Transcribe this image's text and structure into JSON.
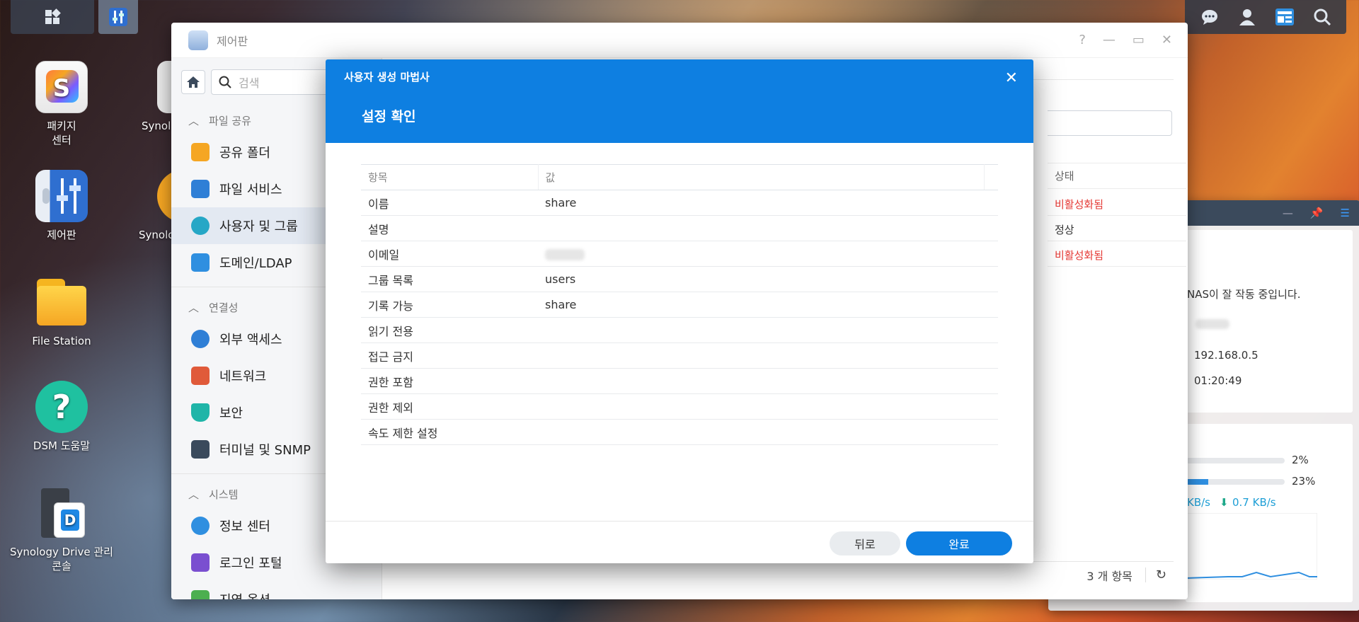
{
  "taskbar": {
    "main_menu_icon": "grid-icon",
    "control_panel_icon": "control-panel-icon",
    "right_icons": [
      "chat-icon",
      "user-icon",
      "widget-icon",
      "search-icon"
    ]
  },
  "desktop_icons": [
    {
      "label": "패키지\n센터",
      "icon": "package-center-icon"
    },
    {
      "label": "제어판",
      "icon": "control-panel-icon"
    },
    {
      "label": "File Station",
      "icon": "file-station-icon"
    },
    {
      "label": "DSM 도움말",
      "icon": "help-icon"
    },
    {
      "label": "Synology Drive 관리\n콘솔",
      "icon": "synology-drive-icon"
    },
    {
      "label": "Synol",
      "icon": "synology-app-icon"
    },
    {
      "label": "Synolo",
      "icon": "synology-app-icon"
    }
  ],
  "control_panel": {
    "title": "제어판",
    "search_placeholder": "검색",
    "sections": [
      {
        "label": "파일 공유",
        "items": [
          {
            "label": "공유 폴더",
            "icon": "shared-folder-icon",
            "color": "#f5a623"
          },
          {
            "label": "파일 서비스",
            "icon": "file-services-icon",
            "color": "#2f7fd6"
          },
          {
            "label": "사용자 및 그룹",
            "icon": "users-icon",
            "color": "#26a7c6",
            "active": true
          },
          {
            "label": "도메인/LDAP",
            "icon": "domain-icon",
            "color": "#2f8fe0"
          }
        ]
      },
      {
        "label": "연결성",
        "items": [
          {
            "label": "외부 액세스",
            "icon": "external-access-icon",
            "color": "#2f7fd6"
          },
          {
            "label": "네트워크",
            "icon": "network-icon",
            "color": "#e05a3a"
          },
          {
            "label": "보안",
            "icon": "security-icon",
            "color": "#1fb5a8"
          },
          {
            "label": "터미널 및 SNMP",
            "icon": "terminal-icon",
            "color": "#3a4a5c"
          }
        ]
      },
      {
        "label": "시스템",
        "items": [
          {
            "label": "정보 센터",
            "icon": "info-center-icon",
            "color": "#2f8fe0"
          },
          {
            "label": "로그인 포털",
            "icon": "login-portal-icon",
            "color": "#7a4fd0"
          },
          {
            "label": "지역 옵션",
            "icon": "regional-icon",
            "color": "#4caf50"
          }
        ]
      }
    ],
    "table_header_status": "상태",
    "statuses": [
      {
        "text": "비활성화됨",
        "color": "#e53935"
      },
      {
        "text": "정상",
        "color": "#333333"
      },
      {
        "text": "비활성화됨",
        "color": "#e53935"
      }
    ],
    "footer_count": "3 개 항목"
  },
  "widget": {
    "status_text": "NAS이 잘 작동 중입니다.",
    "ip": "192.168.0.5",
    "uptime": "01:20:49",
    "cpu_percent": "2%",
    "cpu_fraction": 0.02,
    "ram_percent": "23%",
    "ram_fraction": 0.23,
    "upload": "KB/s",
    "download": "0.7 KB/s"
  },
  "wizard": {
    "title": "사용자 생성 마법사",
    "step_title": "설정 확인",
    "columns": {
      "item": "항목",
      "value": "값"
    },
    "rows": [
      {
        "item": "이름",
        "value": "share"
      },
      {
        "item": "설명",
        "value": ""
      },
      {
        "item": "이메일",
        "value": "",
        "blurred": true
      },
      {
        "item": "그룹 목록",
        "value": "users"
      },
      {
        "item": "기록 가능",
        "value": "share"
      },
      {
        "item": "읽기 전용",
        "value": ""
      },
      {
        "item": "접근 금지",
        "value": ""
      },
      {
        "item": "권한 포함",
        "value": ""
      },
      {
        "item": "권한 제외",
        "value": ""
      },
      {
        "item": "속도 제한 설정",
        "value": ""
      }
    ],
    "back_label": "뒤로",
    "done_label": "완료"
  }
}
